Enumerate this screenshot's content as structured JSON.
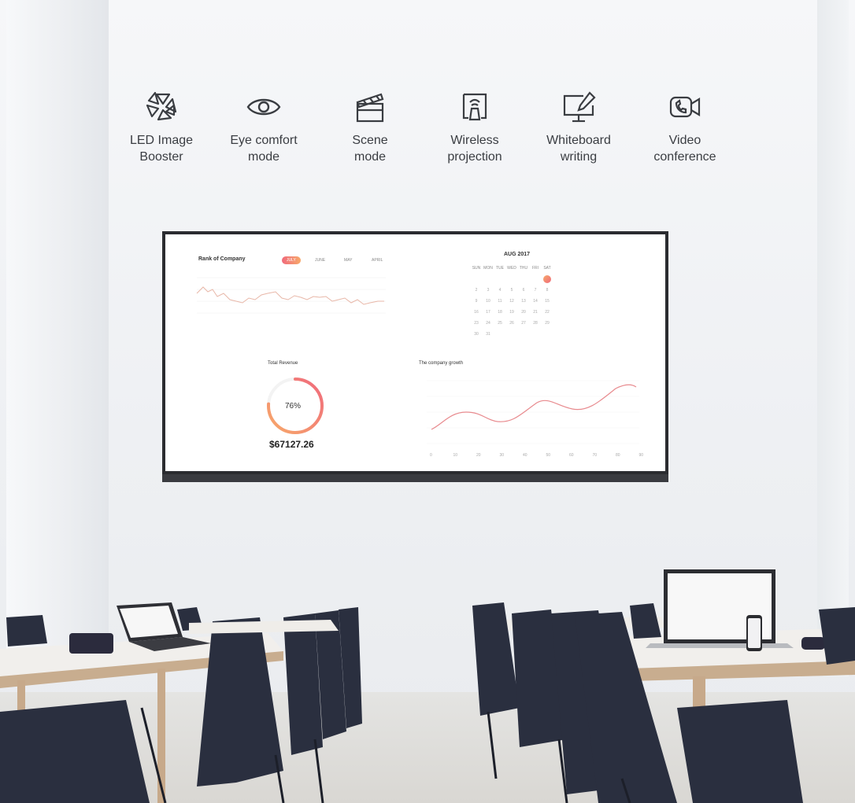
{
  "features": [
    {
      "icon": "led-image-booster-icon",
      "label": "LED Image\nBooster"
    },
    {
      "icon": "eye-icon",
      "label": "Eye comfort\nmode"
    },
    {
      "icon": "clapperboard-icon",
      "label": "Scene\nmode"
    },
    {
      "icon": "wireless-projection-icon",
      "label": "Wireless\nprojection"
    },
    {
      "icon": "whiteboard-icon",
      "label": "Whiteboard\nwriting"
    },
    {
      "icon": "video-conference-icon",
      "label": "Video\nconference"
    }
  ],
  "dashboard": {
    "rank_title": "Rank of Company",
    "tabs": [
      "JULY",
      "JUNE",
      "MAY",
      "APRIL"
    ],
    "calendar": {
      "title": "AUG 2017",
      "weekdays": [
        "SUN",
        "MON",
        "TUE",
        "WED",
        "THU",
        "FRI",
        "SAT"
      ],
      "today": "1",
      "rows": [
        [
          "2",
          "3",
          "4",
          "5",
          "6",
          "7",
          "8"
        ],
        [
          "9",
          "10",
          "11",
          "12",
          "13",
          "14",
          "15"
        ],
        [
          "16",
          "17",
          "18",
          "19",
          "20",
          "21",
          "22"
        ],
        [
          "23",
          "24",
          "25",
          "26",
          "27",
          "28",
          "29"
        ],
        [
          "30",
          "31",
          "",
          "",
          "",
          "",
          ""
        ]
      ]
    },
    "revenue": {
      "title": "Total Revenue",
      "percent_label": "76%",
      "percent": 76,
      "amount": "$67127.26"
    },
    "growth": {
      "title": "The company growth",
      "x_ticks": [
        "0",
        "10",
        "20",
        "30",
        "40",
        "50",
        "60",
        "70",
        "80",
        "90"
      ]
    }
  },
  "colors": {
    "accent_start": "#f7a96a",
    "accent_end": "#f06a7c",
    "tv_frame": "#2b2c30"
  }
}
